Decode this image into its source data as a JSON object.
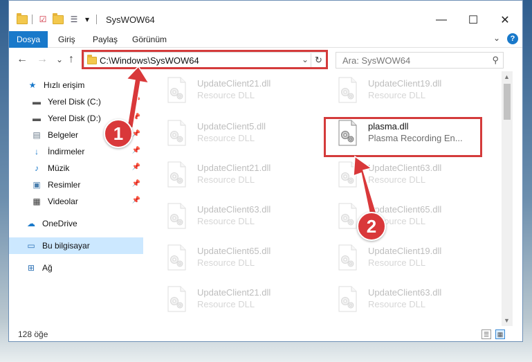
{
  "window": {
    "title": "SysWOW64",
    "qa_dropdown": "▾"
  },
  "ribbon": {
    "tabs": [
      "Dosya",
      "Giriş",
      "Paylaş",
      "Görünüm"
    ]
  },
  "nav": {
    "back": "←",
    "forward": "→",
    "recent": "⌄",
    "up": "↑",
    "address": "C:\\Windows\\SysWOW64",
    "search_placeholder": "Ara: SysWOW64"
  },
  "sidebar": {
    "items": [
      {
        "label": "Hızlı erişim",
        "icon": "star-icon"
      },
      {
        "label": "Yerel Disk (C:)",
        "icon": "drive-icon"
      },
      {
        "label": "Yerel Disk (D:)",
        "icon": "drive-icon"
      },
      {
        "label": "Belgeler",
        "icon": "documents-icon"
      },
      {
        "label": "İndirmeler",
        "icon": "download-icon"
      },
      {
        "label": "Müzik",
        "icon": "music-icon"
      },
      {
        "label": "Resimler",
        "icon": "pictures-icon"
      },
      {
        "label": "Videolar",
        "icon": "video-icon"
      },
      {
        "label": "OneDrive",
        "icon": "cloud-icon"
      },
      {
        "label": "Bu bilgisayar",
        "icon": "computer-icon"
      },
      {
        "label": "Ağ",
        "icon": "network-icon"
      }
    ]
  },
  "files": {
    "left": [
      {
        "name": "UpdateClient21.dll",
        "desc": "Resource DLL"
      },
      {
        "name": "UpdateClient5.dll",
        "desc": "Resource DLL"
      },
      {
        "name": "UpdateClient21.dll",
        "desc": "Resource DLL"
      },
      {
        "name": "UpdateClient63.dll",
        "desc": "Resource DLL"
      },
      {
        "name": "UpdateClient65.dll",
        "desc": "Resource DLL"
      },
      {
        "name": "UpdateClient21.dll",
        "desc": "Resource DLL"
      }
    ],
    "right": [
      {
        "name": "UpdateClient19.dll",
        "desc": "Resource DLL"
      },
      {
        "name": "plasma.dll",
        "desc": "Plasma Recording En..."
      },
      {
        "name": "UpdateClient63.dll",
        "desc": "Resource DLL"
      },
      {
        "name": "UpdateClient65.dll",
        "desc": "Resource DLL"
      },
      {
        "name": "UpdateClient19.dll",
        "desc": "Resource DLL"
      },
      {
        "name": "UpdateClient63.dll",
        "desc": "Resource DLL"
      }
    ]
  },
  "status": {
    "count": "128 öğe"
  },
  "callouts": [
    "1",
    "2"
  ],
  "colors": {
    "accent": "#1979ca",
    "highlight": "#d43b3b",
    "selection": "#cce8ff"
  }
}
